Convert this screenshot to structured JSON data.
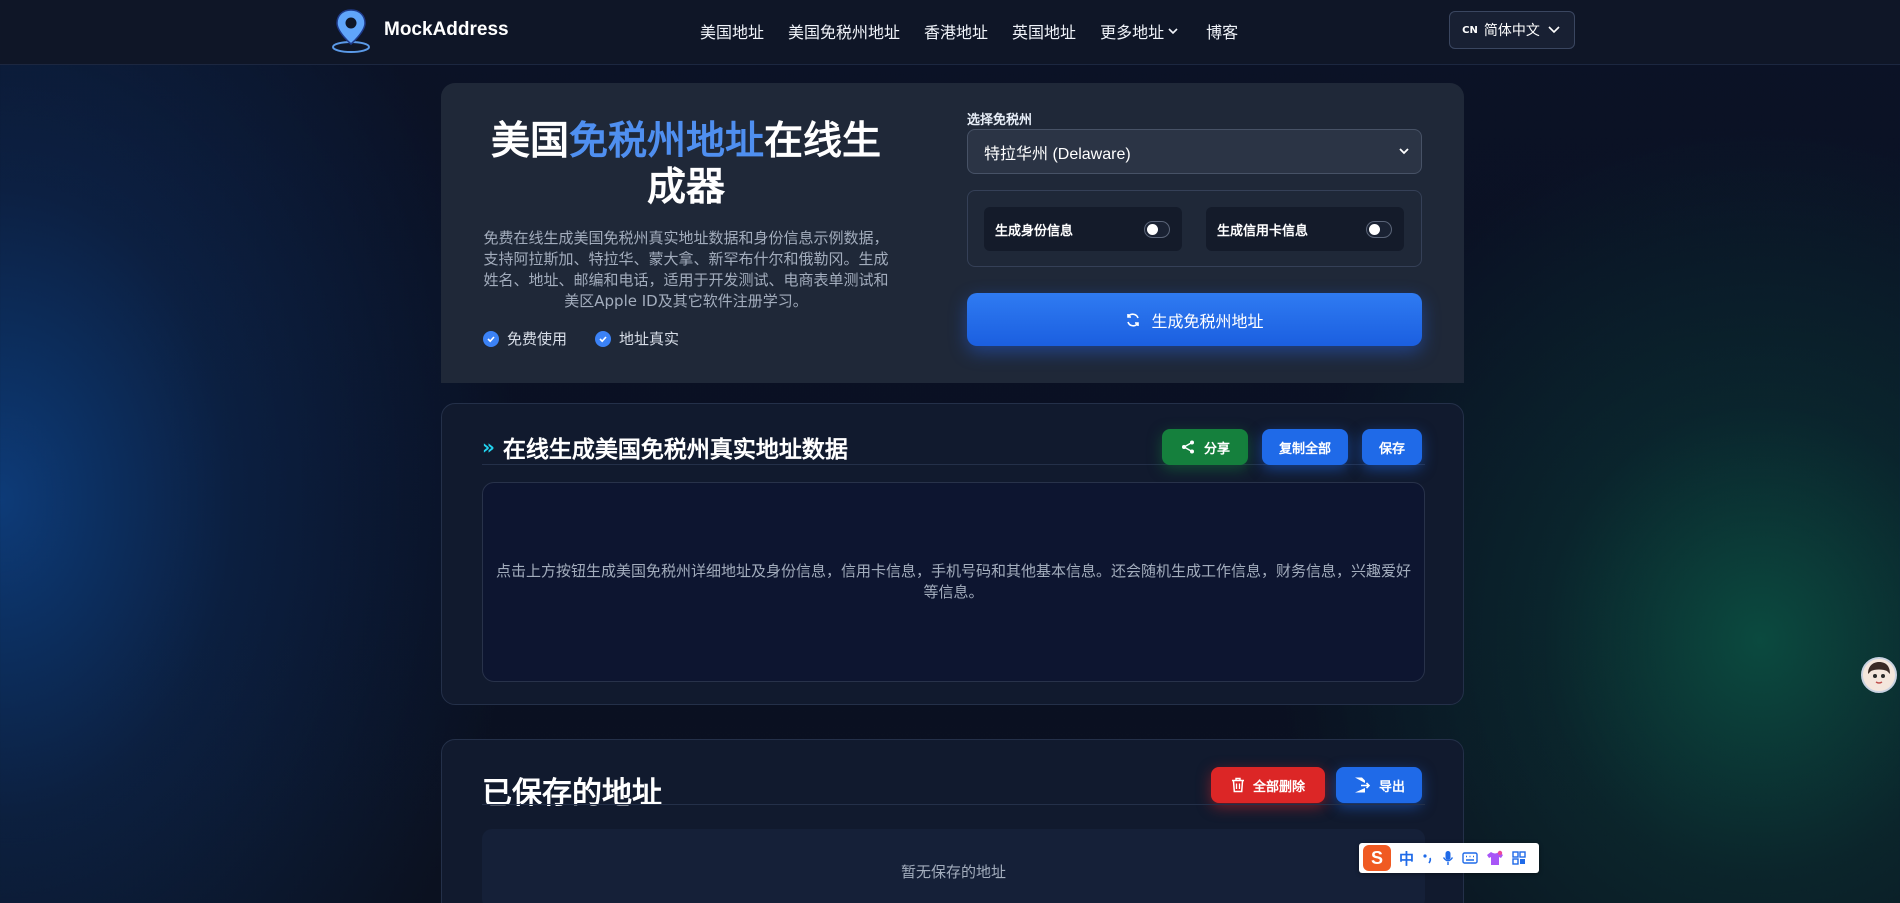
{
  "header": {
    "brand": "MockAddress",
    "nav": [
      {
        "label": "美国地址"
      },
      {
        "label": "美国免税州地址"
      },
      {
        "label": "香港地址"
      },
      {
        "label": "英国地址"
      },
      {
        "label": "更多地址"
      },
      {
        "label": "博客"
      }
    ],
    "lang_code": "CN",
    "lang_label": "简体中文"
  },
  "hero": {
    "title_part1": "美国",
    "title_highlight": "免税州地址",
    "title_part2": "在线生成器",
    "description": "免费在线生成美国免税州真实地址数据和身份信息示例数据，支持阿拉斯加、特拉华、蒙大拿、新罕布什尔和俄勒冈。生成姓名、地址、邮编和电话，适用于开发测试、电商表单测试和美区Apple ID及其它软件注册学习。",
    "features": [
      "免费使用",
      "地址真实"
    ],
    "select_label": "选择免税州",
    "select_value": "特拉华州 (Delaware)",
    "toggle_identity": "生成身份信息",
    "toggle_card": "生成信用卡信息",
    "generate_label": "生成免税州地址"
  },
  "panel": {
    "title": "在线生成美国免税州真实地址数据",
    "share_label": "分享",
    "copy_label": "复制全部",
    "save_label": "保存",
    "placeholder": "点击上方按钮生成美国免税州详细地址及身份信息，信用卡信息，手机号码和其他基本信息。还会随机生成工作信息，财务信息，兴趣爱好等信息。"
  },
  "saved": {
    "title": "已保存的地址",
    "delete_all_label": "全部删除",
    "export_label": "导出",
    "empty_text": "暂无保存的地址"
  },
  "ime": {
    "logo": "S",
    "mode": "中"
  },
  "colors": {
    "accent": "#3b82f6",
    "highlight": "#4f8ff0",
    "green": "#15803d",
    "red": "#dc2626"
  }
}
